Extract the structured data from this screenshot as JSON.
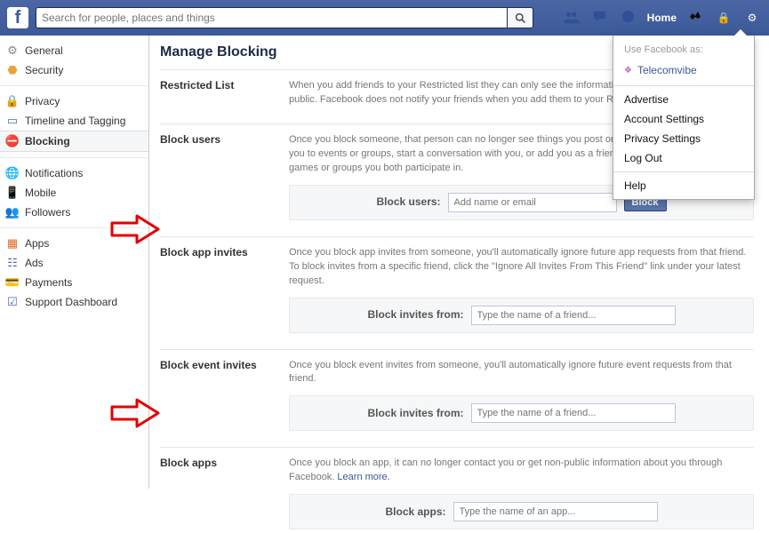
{
  "search": {
    "placeholder": "Search for people, places and things"
  },
  "top": {
    "home": "Home"
  },
  "sidebar": {
    "general": "General",
    "security": "Security",
    "privacy": "Privacy",
    "timeline": "Timeline and Tagging",
    "blocking": "Blocking",
    "notifications": "Notifications",
    "mobile": "Mobile",
    "followers": "Followers",
    "apps": "Apps",
    "ads": "Ads",
    "payments": "Payments",
    "support": "Support Dashboard"
  },
  "page": {
    "title": "Manage Blocking"
  },
  "sections": {
    "restricted": {
      "label": "Restricted List",
      "desc": "When you add friends to your Restricted list they can only see the information and posts that you make public. Facebook does not notify your friends when you add them to your Restricted list."
    },
    "block_users": {
      "label": "Block users",
      "desc": "Once you block someone, that person can no longer see things you post on your timeline, tag you, invite you to events or groups, start a conversation with you, or add you as a friend. Note: Does not include apps, games or groups you both participate in.",
      "input_label": "Block users:",
      "input_ph": "Add name or email",
      "button": "Block"
    },
    "block_app_invites": {
      "label": "Block app invites",
      "desc": "Once you block app invites from someone, you'll automatically ignore future app requests from that friend. To block invites from a specific friend, click the \"Ignore All Invites From This Friend\" link under your latest request.",
      "input_label": "Block invites from:",
      "input_ph": "Type the name of a friend..."
    },
    "block_event_invites": {
      "label": "Block event invites",
      "desc": "Once you block event invites from someone, you'll automatically ignore future event requests from that friend.",
      "input_label": "Block invites from:",
      "input_ph": "Type the name of a friend..."
    },
    "block_apps": {
      "label": "Block apps",
      "desc": "Once you block an app, it can no longer contact you or get non-public information about you through Facebook. ",
      "learn": "Learn more.",
      "input_label": "Block apps:",
      "input_ph": "Type the name of an app..."
    }
  },
  "dropdown": {
    "heading": "Use Facebook as:",
    "user": "Telecomvibe",
    "advertise": "Advertise",
    "account": "Account Settings",
    "privacy": "Privacy Settings",
    "logout": "Log Out",
    "help": "Help"
  }
}
